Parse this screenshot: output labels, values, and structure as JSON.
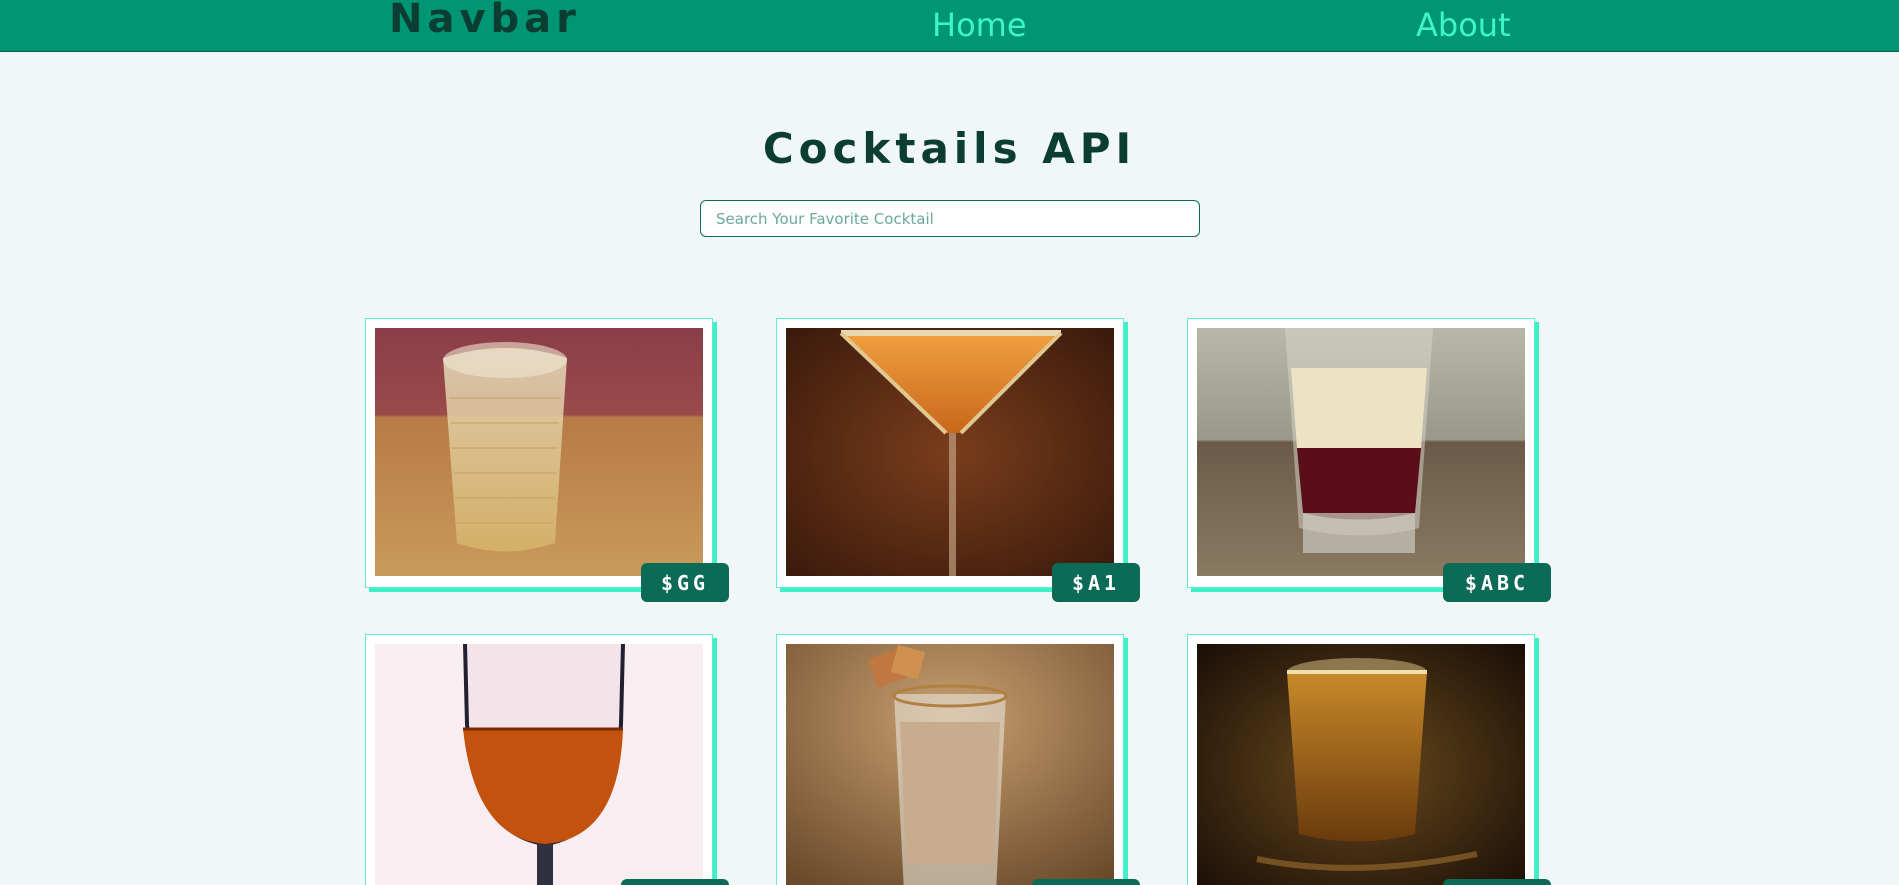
{
  "navbar": {
    "brand": "Navbar",
    "links": [
      {
        "label": "Home"
      },
      {
        "label": "About"
      }
    ]
  },
  "main": {
    "title": "Cocktails API",
    "search": {
      "placeholder": "Search Your Favorite Cocktail",
      "value": ""
    }
  },
  "cocktails": [
    {
      "price": "$GG"
    },
    {
      "price": "$A1"
    },
    {
      "price": "$ABC"
    },
    {
      "price": ""
    },
    {
      "price": ""
    },
    {
      "price": ""
    }
  ],
  "colors": {
    "navbar_bg": "#009673",
    "nav_link": "#3df5c6",
    "brand_text": "#0b3d33",
    "page_bg": "#f0f7f6",
    "badge_bg": "#0b6b56",
    "card_shadow": "#3df0c6"
  }
}
